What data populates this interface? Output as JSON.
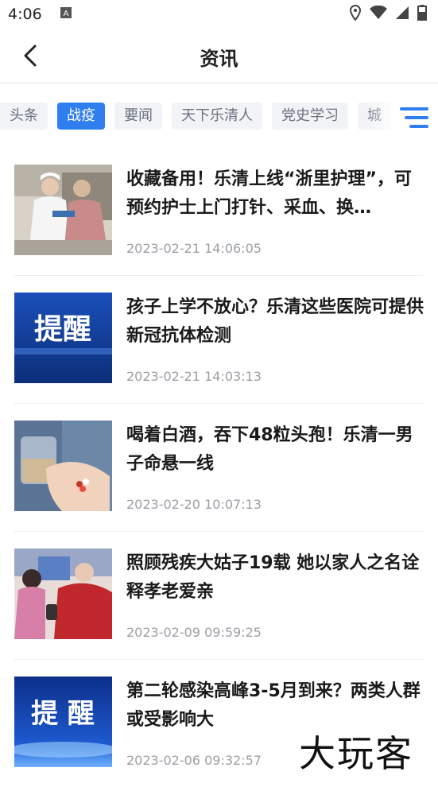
{
  "status": {
    "time": "4:06",
    "icons": [
      "a-notification-icon",
      "location-icon",
      "wifi-icon",
      "signal-icon",
      "battery-icon"
    ]
  },
  "header": {
    "title": "资讯"
  },
  "tabs": [
    {
      "label": "头条",
      "active": false
    },
    {
      "label": "战疫",
      "active": true
    },
    {
      "label": "要闻",
      "active": false
    },
    {
      "label": "天下乐清人",
      "active": false
    },
    {
      "label": "党史学习",
      "active": false
    },
    {
      "label": "城",
      "active": false
    }
  ],
  "colors": {
    "accent": "#2f7ef0",
    "time_text": "#9aa0a6"
  },
  "news": [
    {
      "title": "收藏备用！乐清上线“浙里护理”，可预约护士上门打针、采血、换…",
      "time": "2023-02-21 14:06:05",
      "thumb": "nurse-photo"
    },
    {
      "title": "孩子上学不放心？乐清这些医院可提供新冠抗体检测",
      "time": "2023-02-21 14:03:13",
      "thumb": "reminder-banner",
      "thumb_text": "提醒"
    },
    {
      "title": "喝着白酒，吞下48粒头孢！乐清一男子命悬一线",
      "time": "2023-02-20 10:07:13",
      "thumb": "pills-photo"
    },
    {
      "title": "照顾残疾大姑子19载 她以家人之名诠释孝老爱亲",
      "time": "2023-02-09 09:59:25",
      "thumb": "family-photo"
    },
    {
      "title": "第二轮感染高峰3-5月到来？两类人群或受影响大",
      "time": "2023-02-06 09:32:57",
      "thumb": "reminder-banner",
      "thumb_text": "提 醒"
    }
  ],
  "watermark": "大玩客"
}
